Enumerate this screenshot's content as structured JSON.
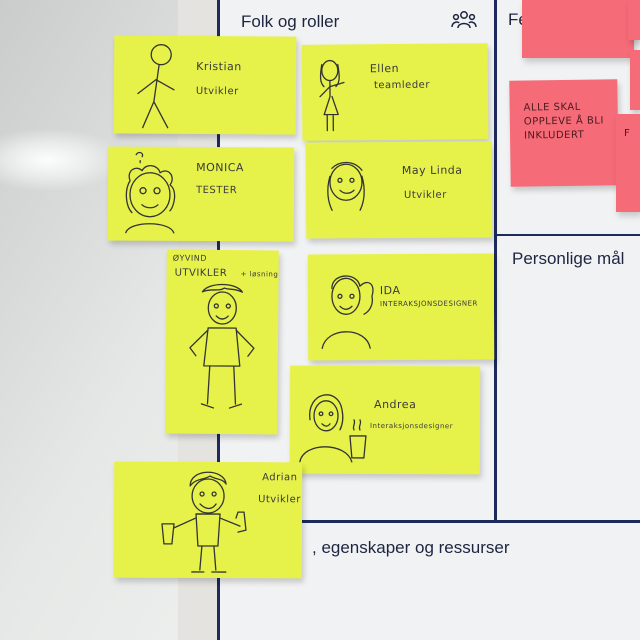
{
  "board": {
    "section_folk": "Folk og roller",
    "section_fe": "Fe",
    "section_personlige": "Personlige mål",
    "section_egenskaper": ", egenskaper og ressurser"
  },
  "notes": {
    "kristian": {
      "name": "Kristian",
      "role": "Utvikler"
    },
    "ellen": {
      "name": "Ellen",
      "role": "teamleder"
    },
    "monica": {
      "name": "MONICA",
      "role": "TESTER"
    },
    "maylinda": {
      "name": "May Linda",
      "role": "Utvikler"
    },
    "oyvind": {
      "name": "ØYVIND",
      "role": "UTVIKLER",
      "extra": "+ løsning"
    },
    "ida": {
      "name": "IDA",
      "role": "INTERAKSJONSDESIGNER"
    },
    "andrea": {
      "name": "Andrea",
      "role": "Interaksjonsdesigner"
    },
    "adrian": {
      "name": "Adrian",
      "role": "Utvikler"
    }
  },
  "pink_notes": {
    "main": [
      "ALLE SKAL",
      "OPPLEVE Å BLI",
      "INKLUDERT"
    ],
    "edge": "F"
  },
  "icons": {
    "people": "people-group-icon"
  },
  "colors": {
    "sticky_yellow": "#e6f24a",
    "sticky_pink": "#f56b78",
    "board_line": "#1c2a5c"
  }
}
